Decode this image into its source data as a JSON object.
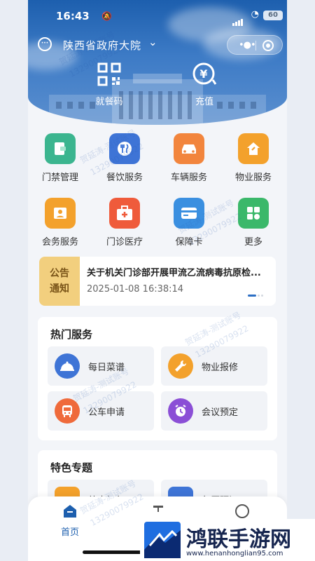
{
  "status": {
    "time": "16:43",
    "battery": "60"
  },
  "location": {
    "name": "陕西省政府大院"
  },
  "hero_actions": [
    {
      "label": "就餐码"
    },
    {
      "label": "充值"
    }
  ],
  "grid": [
    {
      "label": "门禁管理",
      "color": "#3bb58f"
    },
    {
      "label": "餐饮服务",
      "color": "#3e74d6"
    },
    {
      "label": "车辆服务",
      "color": "#f2853d"
    },
    {
      "label": "物业服务",
      "color": "#f3a12c"
    },
    {
      "label": "会务服务",
      "color": "#f3a12c"
    },
    {
      "label": "门诊医疗",
      "color": "#ef5b3b"
    },
    {
      "label": "保障卡",
      "color": "#3a8fe0"
    },
    {
      "label": "更多",
      "color": "#3bb86a"
    }
  ],
  "notice": {
    "tag_line1": "公告",
    "tag_line2": "通知",
    "title": "关于机关门诊部开展甲流乙流病毒抗原检...",
    "date": "2025-01-08 16:38:14"
  },
  "hot_services": {
    "title": "热门服务",
    "items": [
      {
        "label": "每日菜谱",
        "color": "#3e74d6"
      },
      {
        "label": "物业报修",
        "color": "#f3a12c"
      },
      {
        "label": "公车申请",
        "color": "#ef6a3b"
      },
      {
        "label": "会议预定",
        "color": "#8b4fd6"
      }
    ]
  },
  "special": {
    "title": "特色专题",
    "items": [
      {
        "label": "外卖打包"
      },
      {
        "label": "包厢预订"
      }
    ]
  },
  "tabs": [
    {
      "label": "首页"
    }
  ],
  "watermark": {
    "name": "贺延涛-测试账号",
    "phone": "13290079922"
  },
  "ad": {
    "name": "鸿联手游网",
    "url": "www.henanhonglian95.com"
  }
}
